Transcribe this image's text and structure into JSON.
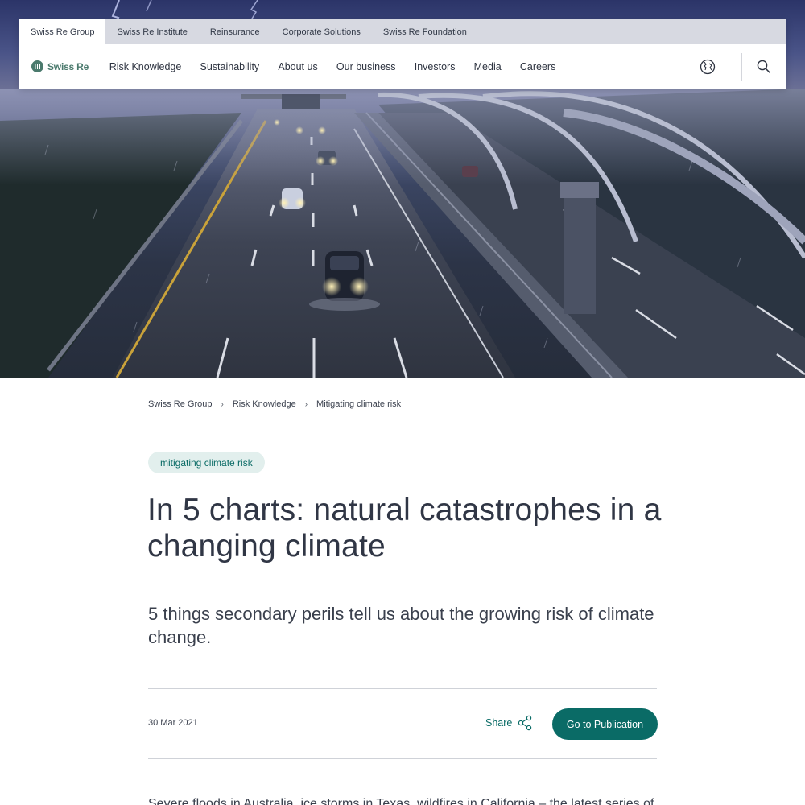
{
  "site": {
    "group_tabs": [
      {
        "label": "Swiss Re Group"
      },
      {
        "label": "Swiss Re Institute"
      },
      {
        "label": "Reinsurance"
      },
      {
        "label": "Corporate Solutions"
      },
      {
        "label": "Swiss Re Foundation"
      }
    ],
    "logo_text": "Swiss Re",
    "nav_items": [
      {
        "label": "Risk Knowledge"
      },
      {
        "label": "Sustainability"
      },
      {
        "label": "About us"
      },
      {
        "label": "Our business"
      },
      {
        "label": "Investors"
      },
      {
        "label": "Media"
      },
      {
        "label": "Careers"
      }
    ],
    "icons": {
      "language": "globe-icon",
      "search": "search-icon",
      "share": "share-icon",
      "breadcrumb_separator": "chevron-right-icon"
    }
  },
  "breadcrumb": [
    {
      "label": "Swiss Re Group"
    },
    {
      "label": "Risk Knowledge"
    },
    {
      "label": "Mitigating climate risk"
    }
  ],
  "article": {
    "tag": "mitigating climate risk",
    "title": "In 5 charts: natural catastrophes in a changing climate",
    "subtitle": "5 things secondary perils tell us about the growing risk of climate change.",
    "date": "30 Mar 2021",
    "share_label": "Share",
    "publication_button": "Go to Publication",
    "body_start": "Severe floods in Australia, ice storms in Texas, wildfires in California – the latest series of"
  },
  "colors": {
    "brand_teal": "#0a6b66",
    "tag_background": "#e2efed",
    "logo_green": "#4b7a6d",
    "group_bar": "#d7d9e1"
  }
}
